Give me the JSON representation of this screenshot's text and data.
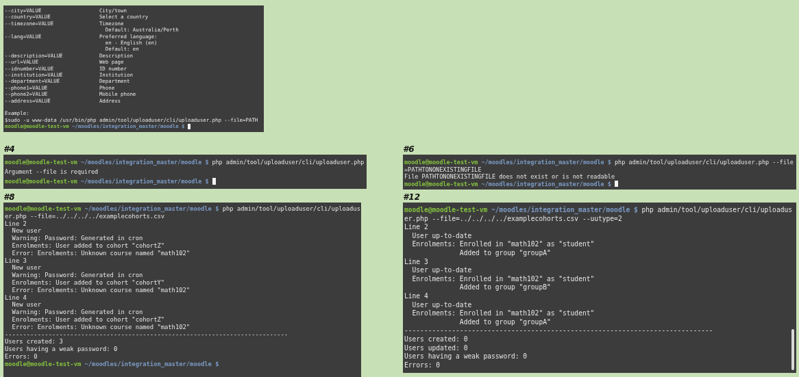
{
  "terminals": [
    {
      "lines": [
        {
          "kind": "option",
          "option": "--city=VALUE",
          "description": "City/town"
        },
        {
          "kind": "option",
          "option": "--country=VALUE",
          "description": "Select a country"
        },
        {
          "kind": "option",
          "option": "--timezone=VALUE",
          "description": "Timezone"
        },
        {
          "kind": "detail",
          "text": "Default: Australia/Perth"
        },
        {
          "kind": "option",
          "option": "--lang=VALUE",
          "description": "Preferred language:"
        },
        {
          "kind": "detail",
          "text": "en - English (en)"
        },
        {
          "kind": "detail",
          "text": "Default: en"
        },
        {
          "kind": "option",
          "option": "--description=VALUE",
          "description": "Description"
        },
        {
          "kind": "option",
          "option": "--url=VALUE",
          "description": "Web page"
        },
        {
          "kind": "option",
          "option": "--idnumber=VALUE",
          "description": "ID number"
        },
        {
          "kind": "option",
          "option": "--institution=VALUE",
          "description": "Institution"
        },
        {
          "kind": "option",
          "option": "--department=VALUE",
          "description": "Department"
        },
        {
          "kind": "option",
          "option": "--phone1=VALUE",
          "description": "Phone"
        },
        {
          "kind": "option",
          "option": "--phone2=VALUE",
          "description": "Mobile phone"
        },
        {
          "kind": "option",
          "option": "--address=VALUE",
          "description": "Address"
        },
        {
          "kind": "blank"
        },
        {
          "kind": "text",
          "text": "Example:"
        },
        {
          "kind": "text",
          "text": "$sudo -u www-data /usr/bin/php admin/tool/uploaduser/cli/uploaduser.php --file=PATH"
        },
        {
          "kind": "prompt",
          "user": "moodle@moodle-test-vm",
          "path": "~/moodles/integration_master/moodle",
          "symbol": "$",
          "cursor": true
        }
      ]
    },
    {
      "label": "#4",
      "lines": [
        {
          "kind": "prompt",
          "user": "moodle@moodle-test-vm",
          "path": "~/moodles/integration_master/moodle",
          "symbol": "$",
          "command": "php admin/tool/uploaduser/cli/uploaduser.php"
        },
        {
          "kind": "text",
          "text": "Argument --file is required"
        },
        {
          "kind": "prompt",
          "user": "moodle@moodle-test-vm",
          "path": "~/moodles/integration_master/moodle",
          "symbol": "$",
          "cursor": true
        }
      ]
    },
    {
      "label": "#6",
      "lines": [
        {
          "kind": "prompt",
          "user": "moodle@moodle-test-vm",
          "path": "~/moodles/integration_master/moodle",
          "symbol": "$",
          "command": "php admin/tool/uploaduser/cli/uploaduser.php --file"
        },
        {
          "kind": "text",
          "text": "=PATHTONONEXISTINGFILE"
        },
        {
          "kind": "text",
          "text": "File PATHTONONEXISTINGFILE does not exist or is not readable"
        },
        {
          "kind": "prompt",
          "user": "moodle@moodle-test-vm",
          "path": "~/moodles/integration_master/moodle",
          "symbol": "$",
          "cursor": true
        }
      ]
    },
    {
      "label": "#8",
      "lines": [
        {
          "kind": "prompt",
          "user": "moodle@moodle-test-vm",
          "path": "~/moodles/integration_master/moodle",
          "symbol": "$",
          "command": "php admin/tool/uploaduser/cli/uploadus"
        },
        {
          "kind": "text",
          "text": "er.php --file=../../../../examplecohorts.csv"
        },
        {
          "kind": "text",
          "text": "Line 2"
        },
        {
          "kind": "text",
          "text": "  New user"
        },
        {
          "kind": "text",
          "text": "  Warning: Password: Generated in cron"
        },
        {
          "kind": "text",
          "text": "  Enrolments: User added to cohort \"cohortZ\""
        },
        {
          "kind": "text",
          "text": "  Error: Enrolments: Unknown course named \"math102\""
        },
        {
          "kind": "text",
          "text": "Line 3"
        },
        {
          "kind": "text",
          "text": "  New user"
        },
        {
          "kind": "text",
          "text": "  Warning: Password: Generated in cron"
        },
        {
          "kind": "text",
          "text": "  Enrolments: User added to cohort \"cohortY\""
        },
        {
          "kind": "text",
          "text": "  Error: Enrolments: Unknown course named \"math102\""
        },
        {
          "kind": "text",
          "text": "Line 4"
        },
        {
          "kind": "text",
          "text": "  New user"
        },
        {
          "kind": "text",
          "text": "  Warning: Password: Generated in cron"
        },
        {
          "kind": "text",
          "text": "  Enrolments: User added to cohort \"cohortZ\""
        },
        {
          "kind": "text",
          "text": "  Error: Enrolments: Unknown course named \"math102\""
        },
        {
          "kind": "text",
          "text": "------------------------------------------------------------------------------"
        },
        {
          "kind": "text",
          "text": "Users created: 3"
        },
        {
          "kind": "text",
          "text": "Users having a weak password: 0"
        },
        {
          "kind": "text",
          "text": "Errors: 0"
        },
        {
          "kind": "prompt",
          "user": "moodle@moodle-test-vm",
          "path": "~/moodles/integration_master/moodle",
          "symbol": "$"
        }
      ]
    },
    {
      "label": "#12",
      "lines": [
        {
          "kind": "prompt",
          "user": "moodle@moodle-test-vm",
          "path": "~/moodles/integration_master/moodle",
          "symbol": "$",
          "command": "php admin/tool/uploaduser/cli/uploadus"
        },
        {
          "kind": "text",
          "text": "er.php --file=../../../../examplecohorts.csv --uutype=2"
        },
        {
          "kind": "text",
          "text": "Line 2"
        },
        {
          "kind": "text",
          "text": "  User up-to-date"
        },
        {
          "kind": "text",
          "text": "  Enrolments: Enrolled in \"math102\" as \"student\""
        },
        {
          "kind": "text",
          "text": "              Added to group \"groupA\""
        },
        {
          "kind": "text",
          "text": "Line 3"
        },
        {
          "kind": "text",
          "text": "  User up-to-date"
        },
        {
          "kind": "text",
          "text": "  Enrolments: Enrolled in \"math102\" as \"student\""
        },
        {
          "kind": "text",
          "text": "              Added to group \"groupB\""
        },
        {
          "kind": "text",
          "text": "Line 4"
        },
        {
          "kind": "text",
          "text": "  User up-to-date"
        },
        {
          "kind": "text",
          "text": "  Enrolments: Enrolled in \"math102\" as \"student\""
        },
        {
          "kind": "text",
          "text": "              Added to group \"groupA\""
        },
        {
          "kind": "text",
          "text": "------------------------------------------------------------------------------"
        },
        {
          "kind": "text",
          "text": "Users created: 0"
        },
        {
          "kind": "text",
          "text": "Users updated: 0"
        },
        {
          "kind": "text",
          "text": "Users having a weak password: 0"
        },
        {
          "kind": "text",
          "text": "Errors: 0"
        }
      ]
    }
  ]
}
